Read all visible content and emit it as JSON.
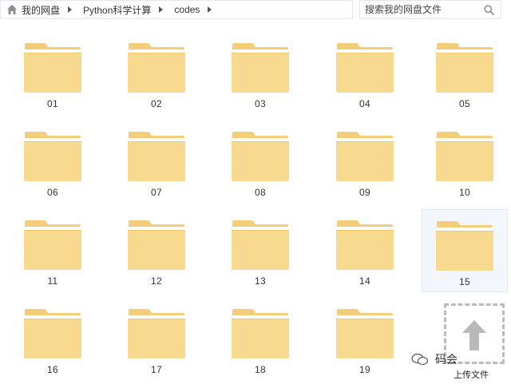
{
  "breadcrumb": {
    "items": [
      "我的网盘",
      "Python科学计算",
      "codes"
    ]
  },
  "search": {
    "placeholder": "搜索我的网盘文件"
  },
  "folders": [
    {
      "label": "01"
    },
    {
      "label": "02"
    },
    {
      "label": "03"
    },
    {
      "label": "04"
    },
    {
      "label": "05"
    },
    {
      "label": "06"
    },
    {
      "label": "07"
    },
    {
      "label": "08"
    },
    {
      "label": "09"
    },
    {
      "label": "10"
    },
    {
      "label": "11"
    },
    {
      "label": "12"
    },
    {
      "label": "13"
    },
    {
      "label": "14"
    },
    {
      "label": "15",
      "selected": true
    },
    {
      "label": "16"
    },
    {
      "label": "17"
    },
    {
      "label": "18"
    },
    {
      "label": "19"
    }
  ],
  "upload": {
    "label": "上传文件"
  },
  "watermark": {
    "text": "码会"
  },
  "colors": {
    "folder_body": "#f7d98f",
    "folder_tab": "#f3cd7a",
    "folder_stripe": "#ffffff",
    "selection_bg": "#f3f7fd"
  },
  "icons": {
    "home": "home-icon",
    "search": "search-icon",
    "folder": "folder-icon",
    "upload": "upload-arrow-icon",
    "wechat": "wechat-icon"
  }
}
